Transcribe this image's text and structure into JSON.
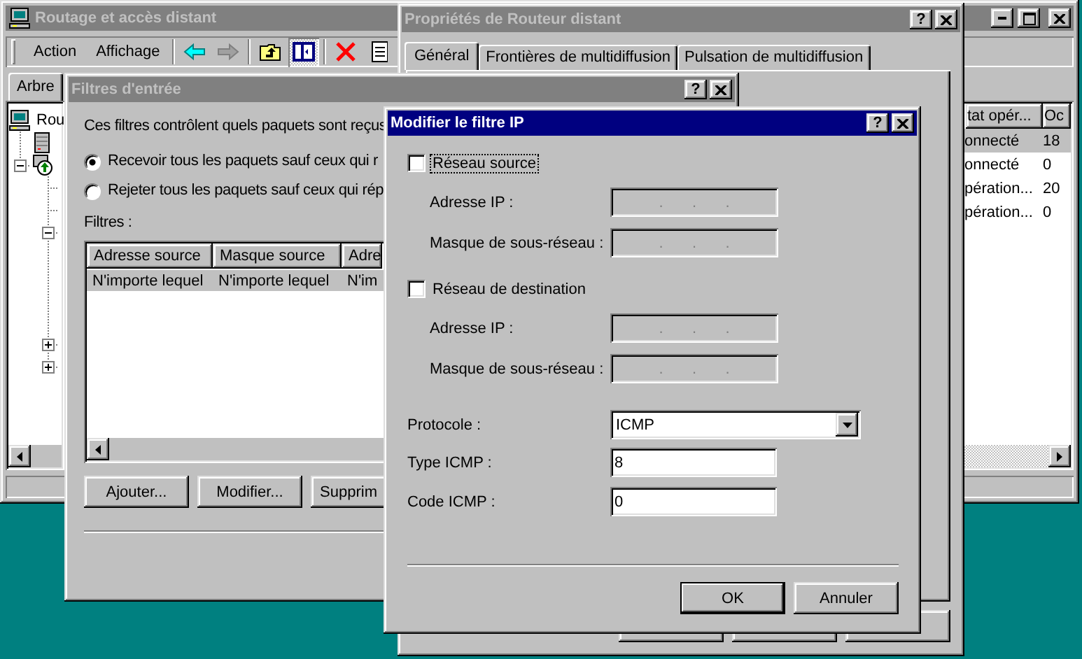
{
  "main_window": {
    "title": "Routage et accès distant",
    "active": false,
    "menus": [
      {
        "label": "Action"
      },
      {
        "label": "Affichage"
      }
    ],
    "toolbar": [
      {
        "kind": "separator"
      },
      {
        "kind": "back",
        "disabled": false
      },
      {
        "kind": "forward",
        "disabled": true
      },
      {
        "kind": "separator"
      },
      {
        "kind": "up",
        "disabled": false
      },
      {
        "kind": "tree",
        "pressed": true
      },
      {
        "kind": "separator"
      },
      {
        "kind": "delete",
        "disabled": false
      },
      {
        "kind": "properties",
        "disabled": false
      }
    ],
    "tabs": [
      {
        "label": "Arbre",
        "selected": true
      }
    ],
    "tree": {
      "label": "Rou",
      "kind": "computer",
      "children": [
        {
          "kind": "server"
        },
        {
          "kind": "routing",
          "expanded": true,
          "children": [
            {
              "kind": "leaf"
            },
            {
              "kind": "leaf"
            },
            {
              "expanded": true
            },
            {
              "expanded": false
            },
            {
              "expanded": false
            }
          ]
        }
      ]
    },
    "list": {
      "columns": [
        "tat opér...",
        "Oc"
      ],
      "rows": [
        {
          "cells": [
            "onnecté",
            "18"
          ],
          "selected": true
        },
        {
          "cells": [
            "onnecté",
            "0"
          ],
          "selected": false
        },
        {
          "cells": [
            "pération...",
            "20"
          ],
          "selected": false
        },
        {
          "cells": [
            "pération...",
            "0"
          ],
          "selected": false
        }
      ]
    }
  },
  "properties_window": {
    "title": "Propriétés de Routeur distant",
    "active": false,
    "help_button": "?",
    "tabs": [
      {
        "label": "Général",
        "selected": true
      },
      {
        "label": "Frontières de multidiffusion",
        "selected": false
      },
      {
        "label": "Pulsation de multidiffusion",
        "selected": false
      }
    ]
  },
  "filters_window": {
    "title": "Filtres d'entrée",
    "active": false,
    "help_button": "?",
    "description": "Ces filtres contrôlent quels paquets sont reçus",
    "options": [
      {
        "label": "Recevoir tous les paquets sauf ceux qui r",
        "selected": true
      },
      {
        "label": "Rejeter tous les paquets sauf ceux qui rép",
        "selected": false
      }
    ],
    "list_label": "Filtres :",
    "list": {
      "columns": [
        "Adresse source",
        "Masque source",
        "Adre"
      ],
      "rows": [
        {
          "cells": [
            "N'importe lequel",
            "N'importe lequel",
            "N'im"
          ],
          "selected": true
        }
      ]
    },
    "buttons": [
      "Ajouter...",
      "Modifier...",
      "Supprim"
    ]
  },
  "ip_filter_dialog": {
    "title": "Modifier le filtre IP",
    "active": true,
    "help_button": "?",
    "sections": [
      {
        "label": "Réseau source",
        "checked": false,
        "focused": true,
        "fields": [
          {
            "label": "Adresse IP :",
            "disabled": true,
            "separators": [
              ".",
              ".",
              "."
            ]
          },
          {
            "label": "Masque de sous-réseau :",
            "disabled": true,
            "separators": [
              ".",
              ".",
              "."
            ]
          }
        ]
      },
      {
        "label": "Réseau de destination",
        "checked": false,
        "focused": false,
        "fields": [
          {
            "label": "Adresse IP :",
            "disabled": true,
            "separators": [
              ".",
              ".",
              "."
            ]
          },
          {
            "label": "Masque de sous-réseau :",
            "disabled": true,
            "separators": [
              ".",
              ".",
              "."
            ]
          }
        ]
      }
    ],
    "protocol": {
      "label": "Protocole :",
      "value": "ICMP"
    },
    "icmp_fields": [
      {
        "label": "Type ICMP :",
        "value": "8"
      },
      {
        "label": "Code ICMP :",
        "value": "0"
      }
    ],
    "buttons": [
      {
        "label": "OK",
        "default": true
      },
      {
        "label": "Annuler",
        "default": false
      }
    ]
  }
}
